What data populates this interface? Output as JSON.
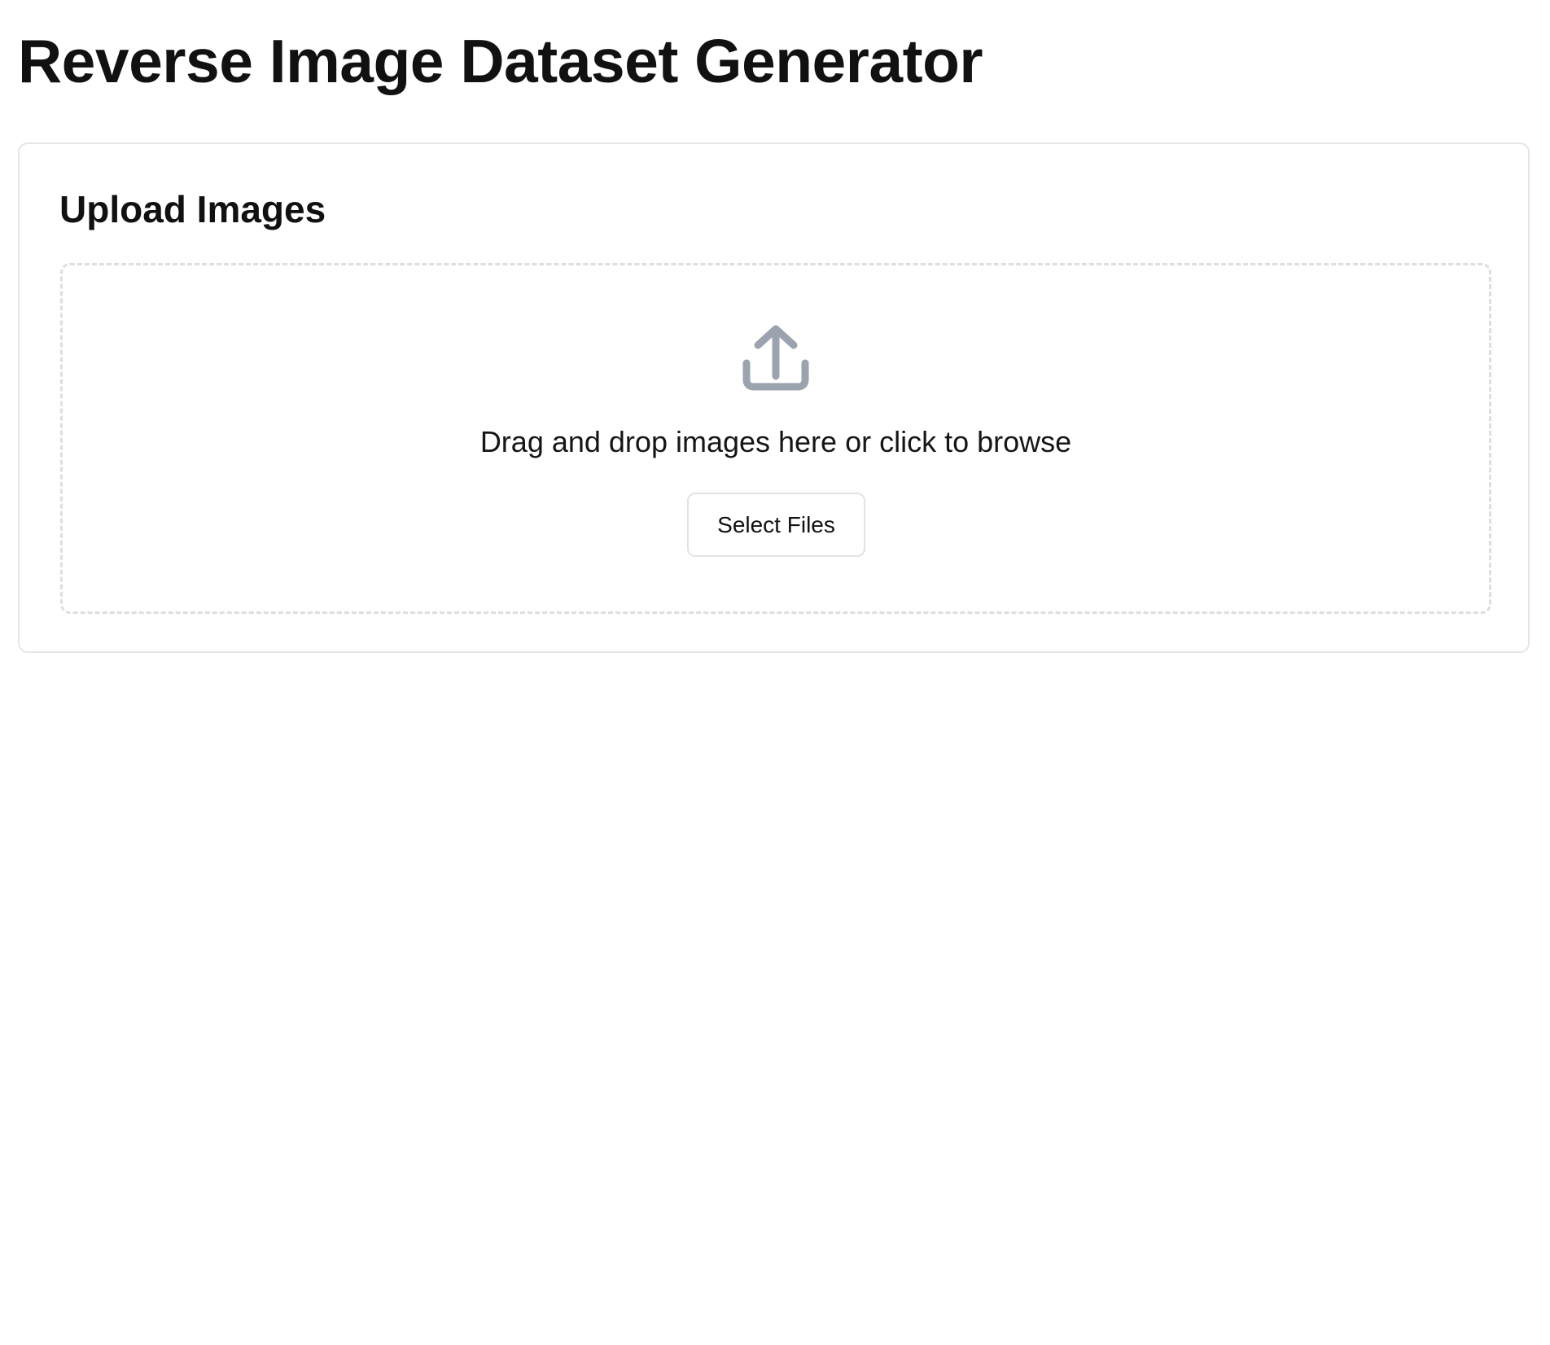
{
  "page": {
    "title": "Reverse Image Dataset Generator"
  },
  "upload_card": {
    "title": "Upload Images",
    "dropzone": {
      "icon": "upload-icon",
      "instructions": "Drag and drop images here or click to browse",
      "button_label": "Select Files"
    }
  },
  "colors": {
    "icon": "#9ba3af",
    "border": "#e6e6e6",
    "dashed_border": "#dedede",
    "text": "#111111",
    "background": "#ffffff"
  }
}
